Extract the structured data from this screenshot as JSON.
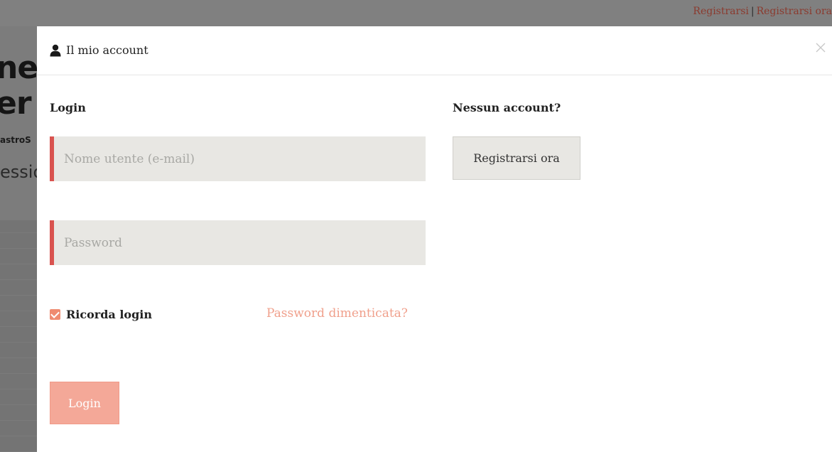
{
  "background": {
    "heading_line1": "ne",
    "heading_line2": "er",
    "subtext": "astroS",
    "word": "essio",
    "top_links": {
      "link1": "Registrarsi",
      "separator": "|",
      "link2": "Registrarsi ora"
    }
  },
  "modal": {
    "title": "Il mio account",
    "close_icon": "close-icon",
    "title_icon": "user-icon",
    "login": {
      "section_title": "Login",
      "username_placeholder": "Nome utente (e-mail)",
      "username_value": "",
      "password_placeholder": "Password",
      "password_value": "",
      "remember_label": "Ricorda login",
      "remember_checked": true,
      "forgot_link": "Password dimenticata?",
      "submit_label": "Login"
    },
    "register": {
      "section_title": "Nessun account?",
      "button_label": "Registrarsi ora"
    }
  },
  "colors": {
    "accent": "#d9534f",
    "link": "#f0a08c",
    "button_primary": "#f4a898",
    "field_bg": "#e8e7e3"
  }
}
